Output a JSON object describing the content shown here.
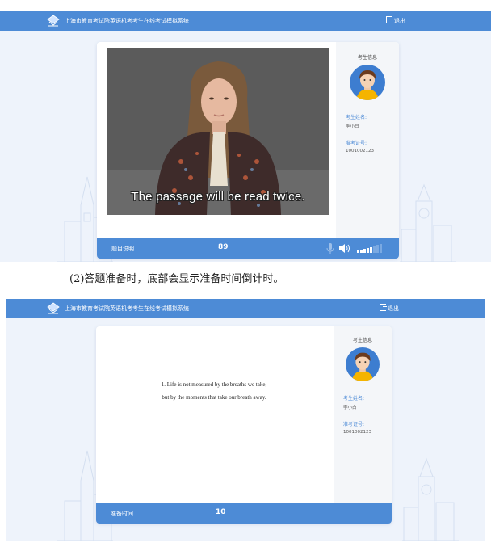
{
  "app": {
    "system_title": "上海市教育考试院英语机考考生在线考试模拟系统",
    "logout_label": "退出"
  },
  "screen1": {
    "video_subtitle": "The passage will be read twice.",
    "info_title": "考生信息",
    "name_label": "考生姓名:",
    "name_value": "李小白",
    "id_label": "准考证号:",
    "id_value": "1001002123",
    "bottom_label": "题目说明",
    "counter": "89"
  },
  "caption": "(2)答题准备时，底部会显示准备时间倒计时。",
  "screen2": {
    "quote_lines": [
      "1. Life is not measured by the breaths we take,",
      "but by the moments that take our breath away."
    ],
    "info_title": "考生信息",
    "name_label": "考生姓名:",
    "name_value": "李小白",
    "id_label": "准考证号:",
    "id_value": "1001002123",
    "bottom_label": "准备时间",
    "counter": "10"
  },
  "colors": {
    "topbar": "#4d8bd6",
    "page_bg": "#eef3fb",
    "avatar_bg": "#3d7dd0",
    "label_blue": "#4d8bd6"
  },
  "icons": [
    "exam-logo-icon",
    "logout-icon",
    "microphone-icon",
    "speaker-icon",
    "volume-level-icon",
    "avatar-icon"
  ]
}
